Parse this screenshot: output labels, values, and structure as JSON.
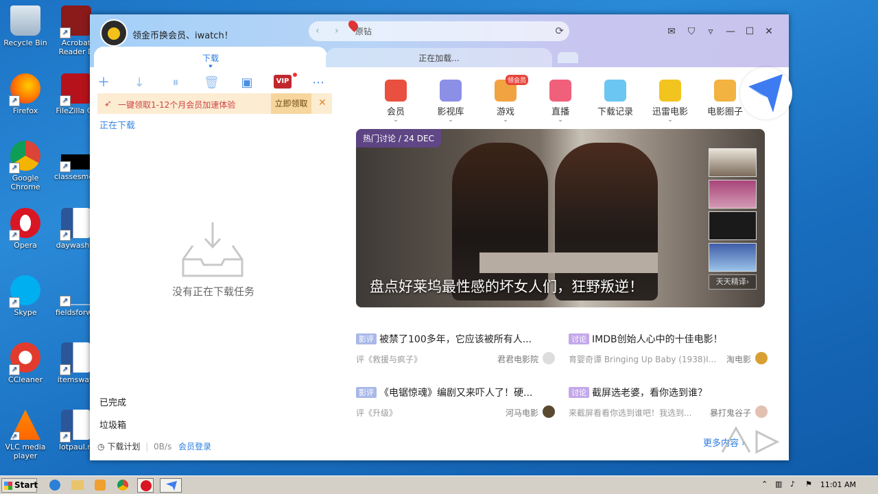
{
  "desktop": {
    "icons": [
      {
        "label": "Recycle Bin"
      },
      {
        "label": "Acrobat Reader D"
      },
      {
        "label": "Firefox"
      },
      {
        "label": "FileZilla Cli"
      },
      {
        "label": "Google Chrome"
      },
      {
        "label": "classesmen"
      },
      {
        "label": "Opera"
      },
      {
        "label": "daywashin"
      },
      {
        "label": "Skype"
      },
      {
        "label": "fieldsforwa"
      },
      {
        "label": "CCleaner"
      },
      {
        "label": "itemsway."
      },
      {
        "label": "VLC media player"
      },
      {
        "label": "lotpaul.rt"
      }
    ]
  },
  "app": {
    "title": "领金币换会员、iwatch！",
    "search": {
      "placeholder": "原钻",
      "value": ""
    },
    "tabs": [
      {
        "label": "下载"
      },
      {
        "label": "正在加载..."
      }
    ],
    "window_controls": [
      "mail-icon",
      "shirt-icon",
      "menu-icon",
      "minimize-icon",
      "maximize-icon",
      "close-icon"
    ]
  },
  "download_panel": {
    "toolbar": [
      "add-icon",
      "download-icon",
      "pause-icon",
      "delete-icon",
      "phone-icon",
      "vip-icon",
      "more-icon"
    ],
    "vip_label": "VIP",
    "banner": {
      "text": "一键领取1-12个月会员加速体验",
      "button": "立即领取"
    },
    "downloading_label": "正在下载",
    "empty_text": "没有正在下载任务",
    "completed_label": "已完成",
    "trash_label": "垃圾箱",
    "footer": {
      "plan": "下载计划",
      "speed": "0B/s",
      "login": "会员登录"
    }
  },
  "content": {
    "categories": [
      {
        "label": "会员",
        "color": "#e9503f",
        "has_menu": true
      },
      {
        "label": "影视库",
        "color": "#8c8fe6",
        "has_menu": true
      },
      {
        "label": "游戏",
        "color": "#f2a341",
        "has_menu": true,
        "badge": "领会员"
      },
      {
        "label": "直播",
        "color": "#f0607a",
        "has_menu": true
      },
      {
        "label": "下载记录",
        "color": "#6cc6f2",
        "has_menu": false
      },
      {
        "label": "迅雷电影",
        "color": "#f2c41f",
        "has_menu": true
      },
      {
        "label": "电影圈子",
        "color": "#f2b340",
        "has_menu": false
      }
    ],
    "hero": {
      "tag": "热门讨论 / 24 DEC",
      "title": "盘点好莱坞最性感的坏女人们，狂野叛逆！",
      "side_button": "天天精译›"
    },
    "news": [
      {
        "tag": "影评",
        "tag_type": "review",
        "title": "被禁了100多年，它应该被所有人...",
        "sub": "评《救援与疯子》",
        "author": "君君电影院"
      },
      {
        "tag": "讨论",
        "tag_type": "discuss",
        "title": "IMDB创始人心中的十佳电影！",
        "sub": "育婴奇谭 Bringing Up Baby (1938)I...",
        "author": "淘电影"
      },
      {
        "tag": "影评",
        "tag_type": "review",
        "title": "《电锯惊魂》编剧又来吓人了！硬...",
        "sub": "评《升级》",
        "author": "河马电影"
      },
      {
        "tag": "讨论",
        "tag_type": "discuss",
        "title": "截屏选老婆，看你选到谁？",
        "sub": "来截屏看看你选到谁吧！我选到...",
        "author": "暴打鬼谷子"
      }
    ],
    "more": "更多内容 ›"
  },
  "taskbar": {
    "start_label": "Start",
    "clock": "11:01 AM"
  }
}
